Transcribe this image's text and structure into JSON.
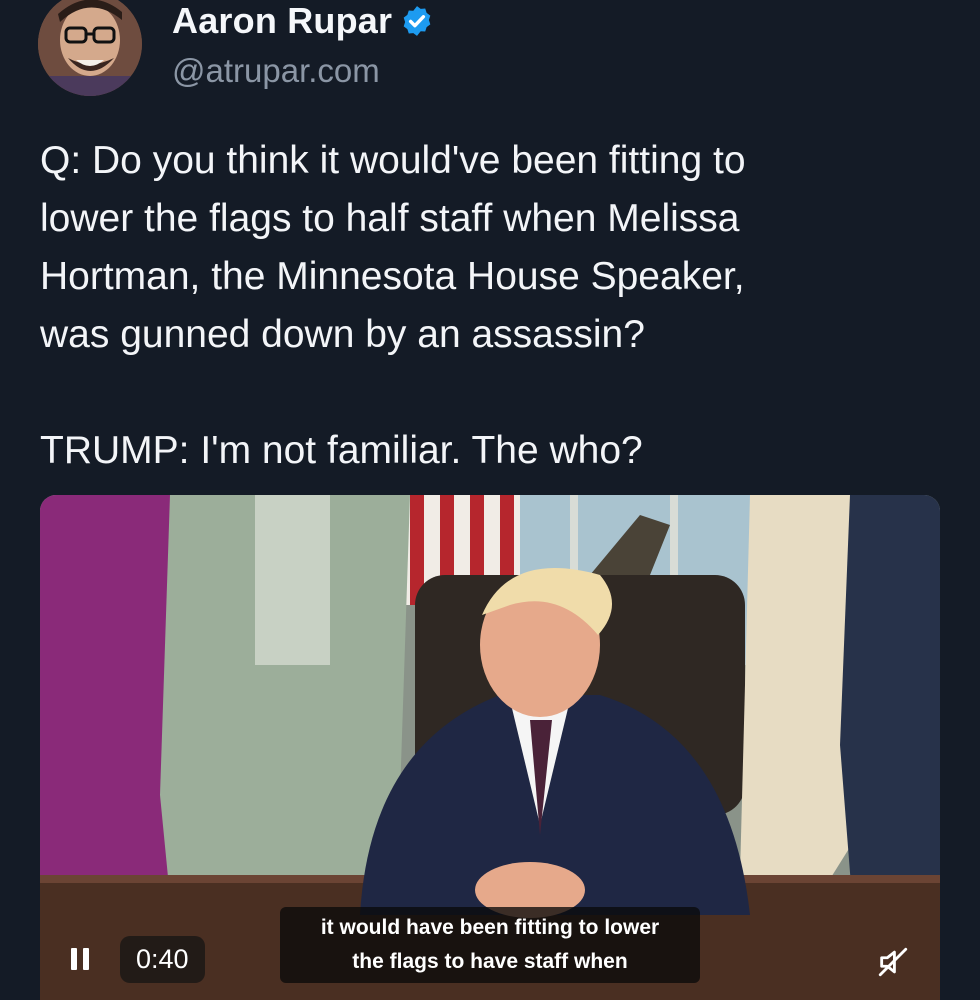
{
  "author": {
    "display_name": "Aaron Rupar",
    "handle": "@atrupar.com",
    "verified_icon": "verified-badge-icon",
    "avatar": "avatar"
  },
  "tweet": {
    "text": "Q: Do you think it would've been fitting to\nlower the flags to half staff when Melissa\nHortman, the Minnesota House Speaker,\nwas gunned down by an assassin?\n\nTRUMP: I'm not familiar. The who?"
  },
  "video": {
    "timestamp": "0:40",
    "caption_lines": [
      "it would have been fitting to lower",
      "the flags to have staff when"
    ],
    "pause_icon": "pause-icon",
    "mute_icon": "muted-speaker-icon"
  },
  "colors": {
    "background": "#141b26",
    "verified_blue": "#1d9bf0",
    "handle_gray": "#8b96a5"
  }
}
